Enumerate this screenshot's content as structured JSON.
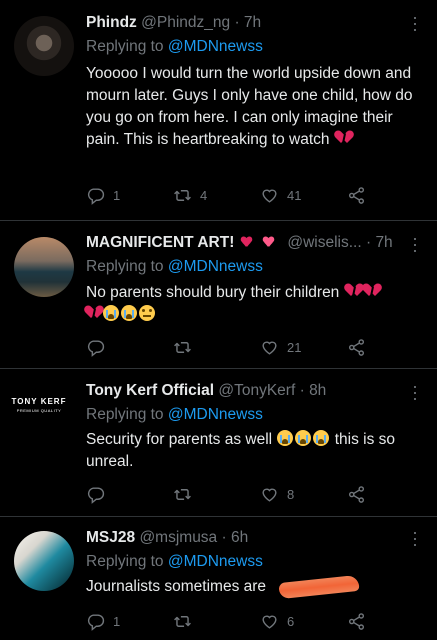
{
  "tweets": [
    {
      "name": "Phindz",
      "handle": "@Phindz_ng",
      "sep": "·",
      "time": "7h",
      "replying_prefix": "Replying to ",
      "replying_handle": "@MDNnewss",
      "body": "Yooooo I would turn the world upside down and mourn later. Guys I only have one child, how do you go on from here. I can only imagine their pain. This is heartbreaking to watch",
      "stats": {
        "replies": "1",
        "retweets": "4",
        "likes": "41"
      }
    },
    {
      "name": "MAGNIFICENT ART!",
      "handle": "@wiselis...",
      "sep": "·",
      "time": "7h",
      "replying_prefix": "Replying to ",
      "replying_handle": "@MDNnewss",
      "body": "No parents should bury their children",
      "stats": {
        "replies": "",
        "retweets": "",
        "likes": "21"
      }
    },
    {
      "name": "Tony Kerf Official",
      "handle": "@TonyKerf",
      "sep": "·",
      "time": "8h",
      "replying_prefix": "Replying to ",
      "replying_handle": "@MDNnewss",
      "body_a": "Security for parents as well",
      "body_b": "this is so unreal.",
      "avatar_text_1": "TONY KERF",
      "avatar_text_2": "PREMIUM QUALITY",
      "stats": {
        "replies": "",
        "retweets": "",
        "likes": "8"
      }
    },
    {
      "name": "MSJ28",
      "handle": "@msjmusa",
      "sep": "·",
      "time": "6h",
      "replying_prefix": "Replying to ",
      "replying_handle": "@MDNnewss",
      "body": "Journalists sometimes are",
      "stats": {
        "replies": "1",
        "retweets": "",
        "likes": "6"
      }
    }
  ],
  "icons": {
    "more": "more-icon",
    "reply": "reply-icon",
    "retweet": "retweet-icon",
    "like": "like-icon",
    "share": "share-icon"
  },
  "colors": {
    "background": "#000000",
    "text": "#e7e9ea",
    "muted": "#71767b",
    "link": "#1d9bf0",
    "divider": "#2f3336"
  }
}
